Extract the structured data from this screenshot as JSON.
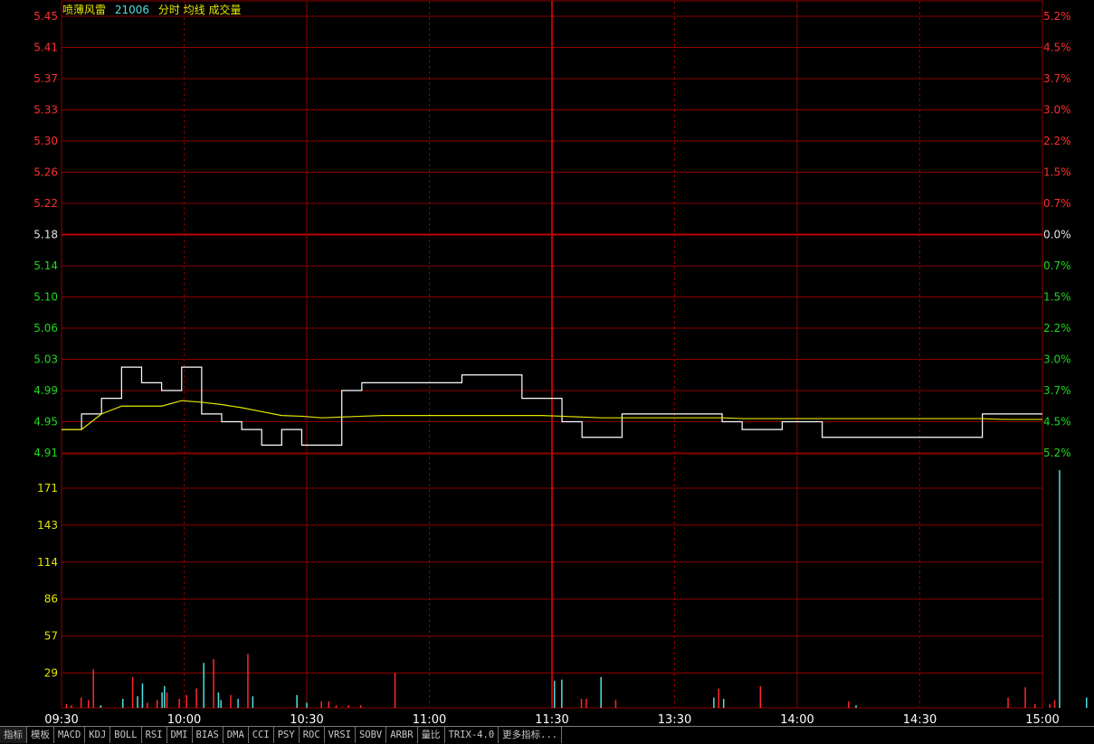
{
  "header": {
    "stock_name": "喷薄风雷",
    "code": "21006",
    "panel_labels": "分时 均线 成交量"
  },
  "colors": {
    "background": "#000000",
    "grid": "#8b0000",
    "grid_center": "#c00000",
    "price_line": "#ffffff",
    "avg_line": "#e6e600",
    "up": "#ff2e2e",
    "down": "#1fd81f",
    "neutral": "#e0e0e0",
    "volume_label": "#e6e600",
    "volume_up": "#ff2a2a",
    "volume_down": "#4fe0e0"
  },
  "chart_data": [
    {
      "type": "line",
      "x": [
        "09:30",
        "09:35",
        "09:40",
        "09:45",
        "09:50",
        "09:55",
        "10:00",
        "10:05",
        "10:10",
        "10:15",
        "10:20",
        "10:25",
        "10:30",
        "10:35",
        "10:40",
        "10:45",
        "10:50",
        "10:55",
        "11:00",
        "11:05",
        "11:10",
        "11:15",
        "11:20",
        "11:25",
        "11:30",
        "13:00",
        "13:05",
        "13:10",
        "13:15",
        "13:20",
        "13:25",
        "13:30",
        "13:35",
        "13:40",
        "13:45",
        "13:50",
        "13:55",
        "14:00",
        "14:05",
        "14:10",
        "14:15",
        "14:20",
        "14:25",
        "14:30",
        "14:35",
        "14:40",
        "14:45",
        "14:50",
        "14:55",
        "15:00"
      ],
      "series": [
        {
          "values": [
            4.94,
            4.96,
            4.98,
            5.02,
            5.0,
            4.99,
            5.02,
            4.96,
            4.95,
            4.94,
            4.92,
            4.94,
            4.92,
            4.92,
            4.99,
            5.0,
            5.0,
            5.0,
            5.0,
            5.0,
            5.01,
            5.01,
            5.01,
            4.98,
            4.98,
            4.95,
            4.93,
            4.93,
            4.96,
            4.96,
            4.96,
            4.96,
            4.96,
            4.95,
            4.94,
            4.94,
            4.95,
            4.95,
            4.93,
            4.93,
            4.93,
            4.93,
            4.93,
            4.93,
            4.93,
            4.93,
            4.96,
            4.96,
            4.96,
            4.96
          ]
        },
        {
          "values": [
            4.94,
            4.94,
            4.96,
            4.97,
            4.97,
            4.97,
            4.977,
            4.975,
            4.972,
            4.968,
            4.963,
            4.958,
            4.957,
            4.955,
            4.956,
            4.957,
            4.958,
            4.958,
            4.958,
            4.958,
            4.958,
            4.958,
            4.958,
            4.958,
            4.958,
            4.957,
            4.956,
            4.955,
            4.955,
            4.955,
            4.955,
            4.955,
            4.955,
            4.955,
            4.954,
            4.954,
            4.954,
            4.954,
            4.954,
            4.954,
            4.954,
            4.954,
            4.954,
            4.954,
            4.954,
            4.954,
            4.954,
            4.953,
            4.953,
            4.953
          ]
        }
      ],
      "y_ticks": [
        "5.45",
        "5.41",
        "5.37",
        "5.33",
        "5.30",
        "5.26",
        "5.22",
        "5.18",
        "5.14",
        "5.10",
        "5.06",
        "5.03",
        "4.99",
        "4.95",
        "4.91"
      ],
      "y_ticks_right": [
        "5.2%",
        "4.5%",
        "3.7%",
        "3.0%",
        "2.2%",
        "1.5%",
        "0.7%",
        "0.0%",
        "0.7%",
        "1.5%",
        "2.2%",
        "3.0%",
        "3.7%",
        "4.5%",
        "5.2%"
      ],
      "ylim": [
        4.91,
        5.45
      ],
      "base_price": 5.18
    },
    {
      "type": "bar",
      "y_ticks": [
        "171",
        "143",
        "114",
        "86",
        "57",
        "29"
      ],
      "ylim": [
        0,
        200
      ],
      "x_ticks": [
        "09:30",
        "10:00",
        "10:30",
        "11:00",
        "11:30",
        "13:30",
        "14:00",
        "14:30",
        "15:00"
      ],
      "bars": [
        {
          "t": 0.02,
          "v": 3,
          "c": "up"
        },
        {
          "t": 0.04,
          "v": 2,
          "c": "up"
        },
        {
          "t": 0.08,
          "v": 8,
          "c": "up"
        },
        {
          "t": 0.11,
          "v": 6,
          "c": "up"
        },
        {
          "t": 0.13,
          "v": 30,
          "c": "up"
        },
        {
          "t": 0.16,
          "v": 2,
          "c": "down"
        },
        {
          "t": 0.25,
          "v": 7,
          "c": "down"
        },
        {
          "t": 0.29,
          "v": 24,
          "c": "up"
        },
        {
          "t": 0.31,
          "v": 9,
          "c": "down"
        },
        {
          "t": 0.33,
          "v": 19,
          "c": "down"
        },
        {
          "t": 0.35,
          "v": 4,
          "c": "up"
        },
        {
          "t": 0.39,
          "v": 6,
          "c": "up"
        },
        {
          "t": 0.41,
          "v": 12,
          "c": "down"
        },
        {
          "t": 0.42,
          "v": 17,
          "c": "down"
        },
        {
          "t": 0.43,
          "v": 12,
          "c": "up"
        },
        {
          "t": 0.48,
          "v": 7,
          "c": "up"
        },
        {
          "t": 0.51,
          "v": 10,
          "c": "up"
        },
        {
          "t": 0.55,
          "v": 15,
          "c": "up"
        },
        {
          "t": 0.58,
          "v": 35,
          "c": "down"
        },
        {
          "t": 0.62,
          "v": 38,
          "c": "up"
        },
        {
          "t": 0.64,
          "v": 12,
          "c": "down"
        },
        {
          "t": 0.65,
          "v": 6,
          "c": "down"
        },
        {
          "t": 0.69,
          "v": 10,
          "c": "up"
        },
        {
          "t": 0.72,
          "v": 7,
          "c": "down"
        },
        {
          "t": 0.76,
          "v": 42,
          "c": "up"
        },
        {
          "t": 0.78,
          "v": 9,
          "c": "down"
        },
        {
          "t": 0.96,
          "v": 10,
          "c": "down"
        },
        {
          "t": 1.0,
          "v": 4,
          "c": "down"
        },
        {
          "t": 1.06,
          "v": 5,
          "c": "up"
        },
        {
          "t": 1.09,
          "v": 5,
          "c": "up"
        },
        {
          "t": 1.12,
          "v": 2,
          "c": "up"
        },
        {
          "t": 1.17,
          "v": 2,
          "c": "up"
        },
        {
          "t": 1.22,
          "v": 2,
          "c": "up"
        },
        {
          "t": 1.36,
          "v": 27,
          "c": "up"
        },
        {
          "t": 2.01,
          "v": 21,
          "c": "down"
        },
        {
          "t": 2.04,
          "v": 22,
          "c": "down"
        },
        {
          "t": 2.12,
          "v": 7,
          "c": "up"
        },
        {
          "t": 2.14,
          "v": 7,
          "c": "up"
        },
        {
          "t": 2.2,
          "v": 24,
          "c": "down"
        },
        {
          "t": 2.26,
          "v": 6,
          "c": "up"
        },
        {
          "t": 2.66,
          "v": 8,
          "c": "down"
        },
        {
          "t": 2.68,
          "v": 15,
          "c": "up"
        },
        {
          "t": 2.7,
          "v": 7,
          "c": "down"
        },
        {
          "t": 2.85,
          "v": 17,
          "c": "up"
        },
        {
          "t": 3.21,
          "v": 5,
          "c": "up"
        },
        {
          "t": 3.24,
          "v": 2,
          "c": "down"
        },
        {
          "t": 3.86,
          "v": 8,
          "c": "up"
        },
        {
          "t": 3.93,
          "v": 16,
          "c": "up"
        },
        {
          "t": 3.97,
          "v": 3,
          "c": "up"
        },
        {
          "t": 4.03,
          "v": 3,
          "c": "up"
        },
        {
          "t": 4.05,
          "v": 6,
          "c": "up"
        },
        {
          "t": 4.07,
          "v": 185,
          "c": "down"
        },
        {
          "t": 4.18,
          "v": 8,
          "c": "down"
        }
      ]
    }
  ],
  "tabs": [
    "指标",
    "模板",
    "MACD",
    "KDJ",
    "BOLL",
    "RSI",
    "DMI",
    "BIAS",
    "DMA",
    "CCI",
    "PSY",
    "ROC",
    "VRSI",
    "SOBV",
    "ARBR",
    "量比",
    "TRIX-4.0",
    "更多指标..."
  ]
}
